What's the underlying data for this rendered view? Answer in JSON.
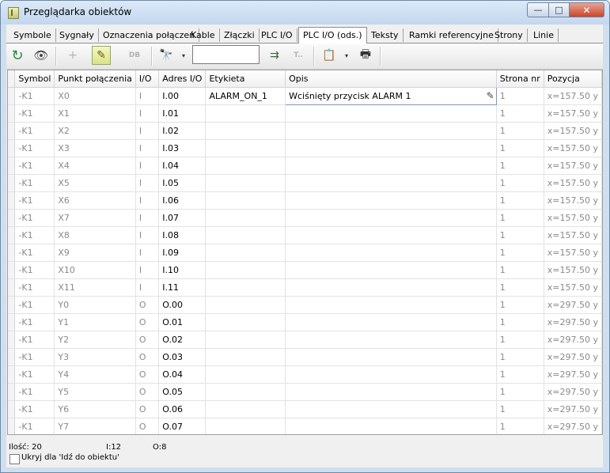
{
  "window": {
    "title": "Przeglądarka obiektów",
    "min": "—",
    "max": "□",
    "close": "✕"
  },
  "tabs": [
    {
      "label": "Symbole",
      "active": false
    },
    {
      "label": "Sygnały",
      "active": false
    },
    {
      "label": "Oznaczenia połączeń",
      "active": false
    },
    {
      "label": "Kable",
      "active": false
    },
    {
      "label": "Złączki",
      "active": false
    },
    {
      "label": "PLC I/O",
      "active": false
    },
    {
      "label": "PLC I/O (ods.)",
      "active": true
    },
    {
      "label": "Teksty",
      "active": false
    },
    {
      "label": "Ramki referencyjne",
      "active": false
    },
    {
      "label": "Strony",
      "active": false
    },
    {
      "label": "Linie",
      "active": false
    }
  ],
  "toolbar": {
    "refresh_icon": "↻",
    "view_icon": "👁",
    "add_icon": "+",
    "edit_icon": "✎",
    "db_label": "DB",
    "find_icon": "🔭",
    "search_value": "",
    "find_next_icon": "⇉",
    "text_label": "T..",
    "export_icon": "📋",
    "print_icon": "🖶",
    "dropdown_icon": "▾"
  },
  "table": {
    "columns": [
      "Symbol",
      "Punkt połączenia",
      "I/O",
      "Adres I/O",
      "Etykieta",
      "Opis",
      "Strona nr",
      "Pozycja"
    ],
    "rows": [
      [
        "-K1",
        "X0",
        "I",
        "I.00",
        "ALARM_ON_1",
        "Wciśnięty przycisk ALARM 1",
        "1",
        "x=157.50 y"
      ],
      [
        "-K1",
        "X1",
        "I",
        "I.01",
        "",
        "",
        "1",
        "x=157.50 y"
      ],
      [
        "-K1",
        "X2",
        "I",
        "I.02",
        "",
        "",
        "1",
        "x=157.50 y"
      ],
      [
        "-K1",
        "X3",
        "I",
        "I.03",
        "",
        "",
        "1",
        "x=157.50 y"
      ],
      [
        "-K1",
        "X4",
        "I",
        "I.04",
        "",
        "",
        "1",
        "x=157.50 y"
      ],
      [
        "-K1",
        "X5",
        "I",
        "I.05",
        "",
        "",
        "1",
        "x=157.50 y"
      ],
      [
        "-K1",
        "X6",
        "I",
        "I.06",
        "",
        "",
        "1",
        "x=157.50 y"
      ],
      [
        "-K1",
        "X7",
        "I",
        "I.07",
        "",
        "",
        "1",
        "x=157.50 y"
      ],
      [
        "-K1",
        "X8",
        "I",
        "I.08",
        "",
        "",
        "1",
        "x=157.50 y"
      ],
      [
        "-K1",
        "X9",
        "I",
        "I.09",
        "",
        "",
        "1",
        "x=157.50 y"
      ],
      [
        "-K1",
        "X10",
        "I",
        "I.10",
        "",
        "",
        "1",
        "x=157.50 y"
      ],
      [
        "-K1",
        "X11",
        "I",
        "I.11",
        "",
        "",
        "1",
        "x=157.50 y"
      ],
      [
        "-K1",
        "Y0",
        "O",
        "O.00",
        "",
        "",
        "1",
        "x=297.50 y"
      ],
      [
        "-K1",
        "Y1",
        "O",
        "O.01",
        "",
        "",
        "1",
        "x=297.50 y"
      ],
      [
        "-K1",
        "Y2",
        "O",
        "O.02",
        "",
        "",
        "1",
        "x=297.50 y"
      ],
      [
        "-K1",
        "Y3",
        "O",
        "O.03",
        "",
        "",
        "1",
        "x=297.50 y"
      ],
      [
        "-K1",
        "Y4",
        "O",
        "O.04",
        "",
        "",
        "1",
        "x=297.50 y"
      ],
      [
        "-K1",
        "Y5",
        "O",
        "O.05",
        "",
        "",
        "1",
        "x=297.50 y"
      ],
      [
        "-K1",
        "Y6",
        "O",
        "O.06",
        "",
        "",
        "1",
        "x=297.50 y"
      ],
      [
        "-K1",
        "Y7",
        "O",
        "O.07",
        "",
        "",
        "1",
        "x=297.50 y"
      ]
    ]
  },
  "status": {
    "count": "Ilość: 20",
    "inputs": "I:12",
    "outputs": "O:8",
    "hide_label": "Ukryj dla 'Idź do obiektu'"
  }
}
